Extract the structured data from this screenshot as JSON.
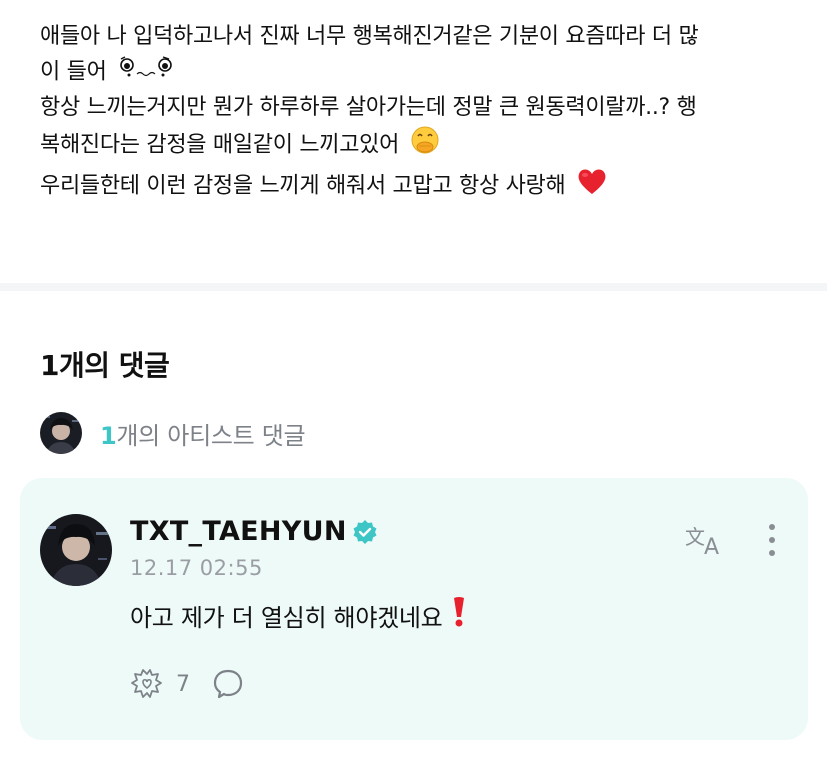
{
  "post": {
    "lines": [
      "애들아 나 입덕하고나서 진짜 너무 행복해진거같은 기분이 요즘따라 더 많",
      "이 들어",
      "항상 느끼는거지만 뭔가 하루하루 살아가는데 정말 큰 원동력이랄까..? 행",
      "복해진다는 감정을 매일같이 느끼고있어",
      "우리들한테 이런 감정을 느끼게 해줘서 고맙고 항상 사랑해"
    ],
    "emojis": [
      "crying-face-emoji",
      "hand-over-mouth-emoji",
      "red-heart-emoji"
    ]
  },
  "comments": {
    "count_label": "1개의 댓글",
    "artist_summary": {
      "count": "1",
      "label": "개의 아티스트 댓글"
    }
  },
  "comment": {
    "author": "TXT_TAEHYUN",
    "verified": true,
    "timestamp": "12.17 02:55",
    "text": "아고 제가 더 열심히 해야겠네요",
    "text_emoji": "red-exclamation-emoji",
    "like_count": "7"
  },
  "colors": {
    "accent_teal": "#3ec6c6",
    "card_background": "#eefaf8",
    "muted_text": "#7d8188",
    "timestamp_text": "#9a9ea4",
    "heart_red": "#e8212e"
  },
  "icons": {
    "translate": "translate-icon",
    "more": "more-vertical-icon",
    "like": "sparkle-heart-icon",
    "reply": "speech-bubble-icon",
    "verified": "verified-badge-icon"
  }
}
